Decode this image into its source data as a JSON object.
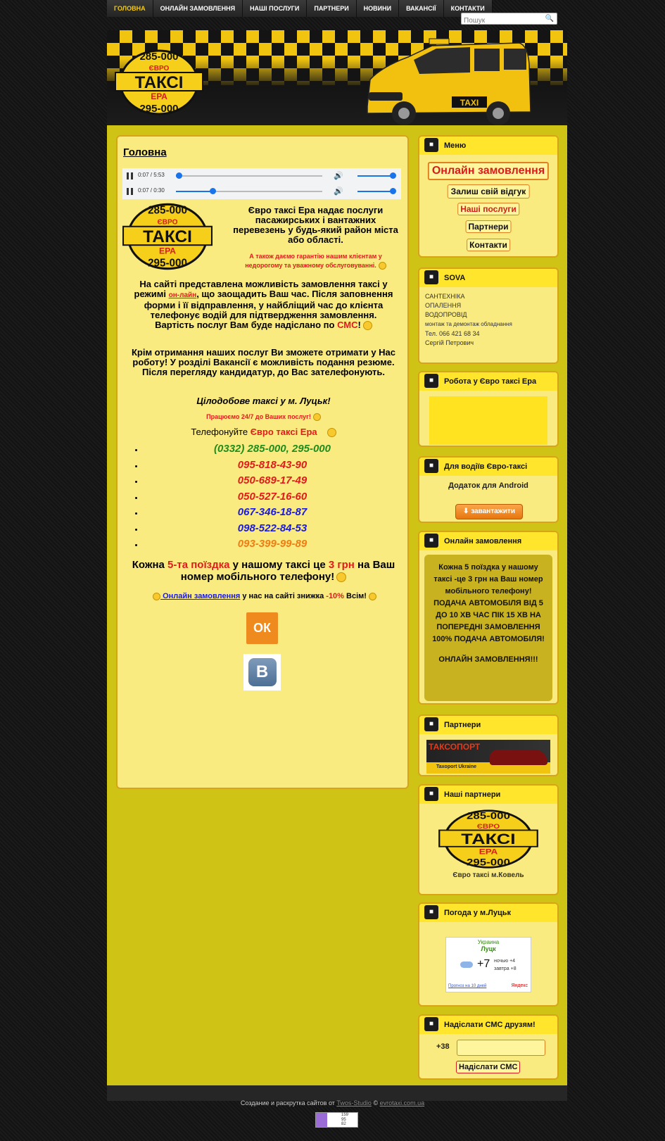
{
  "nav": {
    "items": [
      {
        "label": "ГОЛОВНА",
        "active": true
      },
      {
        "label": "ОНЛАЙН ЗАМОВЛЕННЯ"
      },
      {
        "label": "НАШІ ПОСЛУГИ"
      },
      {
        "label": "ПАРТНЕРИ"
      },
      {
        "label": "НОВИНИ"
      },
      {
        "label": "ВАКАНСІЇ"
      },
      {
        "label": "КОНТАКТИ"
      }
    ],
    "search_placeholder": "Пошук"
  },
  "logo": {
    "top": "285-000",
    "word1": "ЄВРО",
    "word2": "ТАКСІ",
    "word3": "ЕРА",
    "bottom": "295-000"
  },
  "taxi_sign": "TAXI",
  "content": {
    "title": "Головна",
    "players": [
      {
        "time": "0:07 / 5:53",
        "progress": 0.02
      },
      {
        "time": "0:07 / 0:30",
        "progress": 0.23
      }
    ],
    "intro": "Євро таксі Ера надає послуги пасажирських і вантажних перевезень у будь-який район міста або області.",
    "guarantee": "А також даємо гарантію нашим клієнтам у недорогому та уважному обслуговуванні.",
    "p1_a": "На сайті представлена можливість замовлення таксі у режимі ",
    "p1_link": "он-лайн",
    "p1_b": ", що заощадить Ваш час. Після заповнення форми і її відправлення, у найбліщий час до клієнта телефонує водій для підтвердження замовлення.",
    "p1_c": "Вартість послуг Вам буде надіслано по ",
    "p1_sms": "СМС",
    "p1_d": "!",
    "p2": "Крім отримання наших послуг Ви зможете отримати у Нас роботу! У розділі Вакансії є можливість подання резюме. Після перегляду кандидатур, до Вас зателефонують.",
    "p3": "Цілодобове таксі у м. Луцьк!",
    "p4": "Працюємо 24/7 до Ваших послуг!",
    "call_a": "Телефонуйте ",
    "call_b": "Євро таксі Ера",
    "phones": [
      {
        "text": "(0332) 285-000,   295-000",
        "color": "#1e8c1e"
      },
      {
        "text": "095-818-43-90",
        "color": "#e11b1b"
      },
      {
        "text": "050-689-17-49",
        "color": "#e11b1b"
      },
      {
        "text": "050-527-16-60",
        "color": "#e11b1b"
      },
      {
        "text": "067-346-18-87",
        "color": "#1a1adf"
      },
      {
        "text": "098-522-84-53",
        "color": "#1a1adf"
      },
      {
        "text": "093-399-99-89",
        "color": "#ef7d14"
      }
    ],
    "promo_a": "Кожна ",
    "promo_b": "5-та поїздка",
    "promo_c": " у нашому таксі це ",
    "promo_d": "3 грн",
    "promo_e": " на Ваш номер мобільного телефону!",
    "discount_link": " Онлайн замовлення",
    "discount_a": " у нас на сайті знижка ",
    "discount_b": "-10%",
    "discount_c": " Всім!",
    "ok_letter": "ОК",
    "vk_letter": "В"
  },
  "sidebar": {
    "menu": {
      "title": "Меню",
      "buttons": [
        "Онлайн замовлення",
        "Залиш свій відгук",
        "Наші послуги",
        "Партнери",
        "Контакти"
      ]
    },
    "sova": {
      "title": "SOVA",
      "lines": [
        "САНТЕХНІКА",
        "ОПАЛЕННЯ",
        "ВОДОПРОВІД",
        "монтаж та демонтаж обладнання",
        "Тел. 066 421 68 34",
        "Сергій Петрович"
      ]
    },
    "work": {
      "title": "Робота у Євро таксі Ера"
    },
    "drivers": {
      "title": "Для водіїв Євро-таксі",
      "text": "Додаток для Android",
      "button": "завантажити"
    },
    "order": {
      "title": "Онлайн замовлення",
      "lines": [
        "Кожна 5 поїздка у нашому таксі -це 3 грн на Ваш номер мобільного телефону!",
        "ПОДАЧА АВТОМОБІЛЯ ВІД 5 ДО 10 ХВ ЧАС ПІК 15 ХВ НА ПОПЕРЕДНІ ЗАМОВЛЕННЯ 100% ПОДАЧА АВТОМОБІЛЯ!"
      ],
      "cta": "ОНЛАЙН ЗАМОВЛЕННЯ!!!"
    },
    "partners": {
      "title": "Партнери",
      "banner_title": "ТАКСОПОРТ",
      "banner_sub": "Taxoport Ukraine"
    },
    "our_partners": {
      "title": "Наші партнери",
      "caption": "Євро таксі м.Ковель"
    },
    "weather": {
      "title": "Погода у м.Луцьк",
      "country": "Украина",
      "city": "Луцк",
      "temp": "+7",
      "night": "ночью +4",
      "tomorrow": "завтра +8",
      "forecast_link": "Прогноз на 10 дней",
      "brand": "Яндекс"
    },
    "sms": {
      "title": "Надіслати СМС друзям!",
      "prefix": "+38",
      "button": "Надіслати СМС"
    }
  },
  "footer": {
    "text": "Создание и раскрутка сайтов от ",
    "studio": "Twos-Studio",
    "sep": " © ",
    "site": "evrotaxi.com.ua"
  },
  "counter": {
    "lines": [
      "159",
      "95",
      "82"
    ]
  }
}
